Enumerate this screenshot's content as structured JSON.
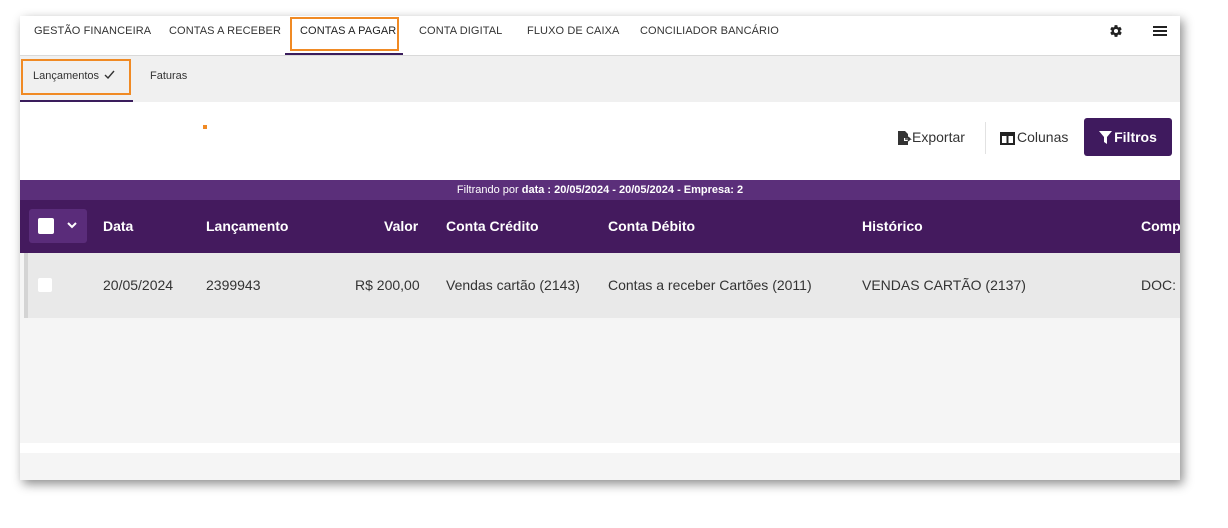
{
  "top_nav": {
    "tabs": [
      {
        "label": "GESTÃO FINANCEIRA"
      },
      {
        "label": "CONTAS A RECEBER"
      },
      {
        "label": "CONTAS A PAGAR"
      },
      {
        "label": "CONTA DIGITAL"
      },
      {
        "label": "FLUXO DE CAIXA"
      },
      {
        "label": "CONCILIADOR BANCÁRIO"
      }
    ],
    "active_tab": "CONTAS A PAGAR",
    "icons": [
      "gear-icon",
      "hamburger-menu-icon"
    ]
  },
  "sub_nav": {
    "tabs": [
      {
        "label": "Lançamentos"
      },
      {
        "label": "Faturas"
      }
    ],
    "active_tab": "Lançamentos"
  },
  "toolbar": {
    "export_label": "Exportar",
    "columns_label": "Colunas",
    "filters_label": "Filtros"
  },
  "filter_info": {
    "prefix": "Filtrando por",
    "detail": "data : 20/05/2024 - 20/05/2024 - Empresa: 2"
  },
  "table": {
    "headers": [
      "Data",
      "Lançamento",
      "Valor",
      "Conta Crédito",
      "Conta Débito",
      "Histórico",
      "Comp"
    ],
    "rows": [
      [
        "20/05/2024",
        "2399943",
        "R$ 200,00",
        "Vendas cartão (2143)",
        "Contas a receber Cartões (2011)",
        "VENDAS CARTÃO (2137)",
        "DOC: "
      ]
    ]
  },
  "colors": {
    "primary_purple": "#441a5e",
    "filter_bar_purple": "#5b2f7a",
    "highlight_orange": "#f08a24"
  }
}
